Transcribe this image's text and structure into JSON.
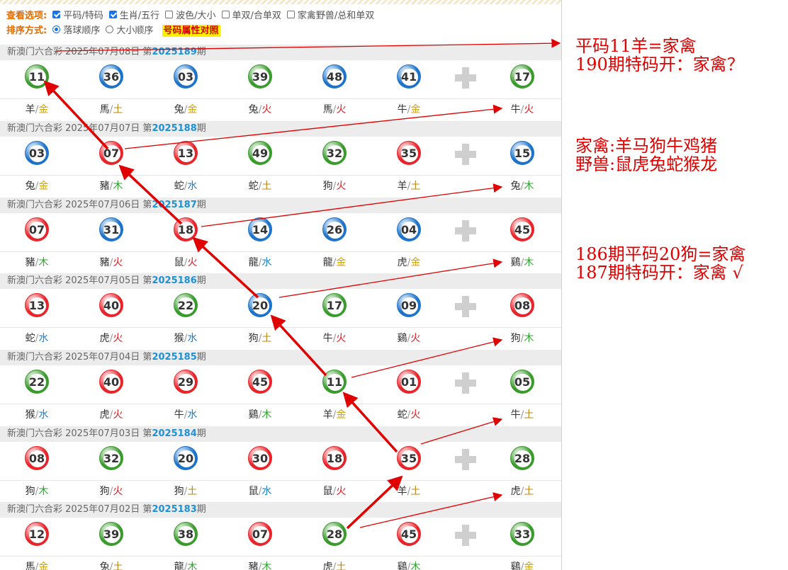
{
  "options": {
    "view_label": "查看选项:",
    "checkboxes": [
      {
        "label": "平码/特码",
        "checked": true
      },
      {
        "label": "生肖/五行",
        "checked": true
      },
      {
        "label": "波色/大小",
        "checked": false
      },
      {
        "label": "单双/合单双",
        "checked": false
      },
      {
        "label": "家禽野兽/总和单双",
        "checked": false
      }
    ],
    "sort_label": "排序方式:",
    "radios": [
      {
        "label": "落球顺序",
        "checked": true
      },
      {
        "label": "大小顺序",
        "checked": false
      }
    ],
    "attr_link": "号码属性对照"
  },
  "colors": {
    "red": "#e8242b",
    "blue": "#1d73c9",
    "green": "#3a9b2d",
    "gold": "#d4a200",
    "wood": "#2aa52a",
    "water": "#1a7fd0",
    "fire": "#e3181f",
    "earth": "#b8860b"
  },
  "draws": [
    {
      "prefix": "新澳门六合彩 2025年07月08日 第",
      "period": "2025189",
      "suffix": "期",
      "balls": [
        {
          "n": "11",
          "c": "green"
        },
        {
          "n": "36",
          "c": "blue"
        },
        {
          "n": "03",
          "c": "blue"
        },
        {
          "n": "39",
          "c": "green"
        },
        {
          "n": "48",
          "c": "blue"
        },
        {
          "n": "41",
          "c": "blue"
        },
        {
          "n": "17",
          "c": "green"
        }
      ],
      "zodiac": [
        {
          "z": "羊",
          "e": "金"
        },
        {
          "z": "馬",
          "e": "土"
        },
        {
          "z": "兔",
          "e": "金"
        },
        {
          "z": "兔",
          "e": "火"
        },
        {
          "z": "馬",
          "e": "火"
        },
        {
          "z": "牛",
          "e": "金"
        },
        {
          "z": "牛",
          "e": "火"
        }
      ]
    },
    {
      "prefix": "新澳门六合彩 2025年07月07日 第",
      "period": "2025188",
      "suffix": "期",
      "balls": [
        {
          "n": "03",
          "c": "blue"
        },
        {
          "n": "07",
          "c": "red"
        },
        {
          "n": "13",
          "c": "red"
        },
        {
          "n": "49",
          "c": "green"
        },
        {
          "n": "32",
          "c": "green"
        },
        {
          "n": "35",
          "c": "red"
        },
        {
          "n": "15",
          "c": "blue"
        }
      ],
      "zodiac": [
        {
          "z": "兔",
          "e": "金"
        },
        {
          "z": "豬",
          "e": "木"
        },
        {
          "z": "蛇",
          "e": "水"
        },
        {
          "z": "蛇",
          "e": "土"
        },
        {
          "z": "狗",
          "e": "火"
        },
        {
          "z": "羊",
          "e": "土"
        },
        {
          "z": "兔",
          "e": "木"
        }
      ]
    },
    {
      "prefix": "新澳门六合彩 2025年07月06日 第",
      "period": "2025187",
      "suffix": "期",
      "balls": [
        {
          "n": "07",
          "c": "red"
        },
        {
          "n": "31",
          "c": "blue"
        },
        {
          "n": "18",
          "c": "red"
        },
        {
          "n": "14",
          "c": "blue"
        },
        {
          "n": "26",
          "c": "blue"
        },
        {
          "n": "04",
          "c": "blue"
        },
        {
          "n": "45",
          "c": "red"
        }
      ],
      "zodiac": [
        {
          "z": "豬",
          "e": "木"
        },
        {
          "z": "豬",
          "e": "火"
        },
        {
          "z": "鼠",
          "e": "火"
        },
        {
          "z": "龍",
          "e": "水"
        },
        {
          "z": "龍",
          "e": "金"
        },
        {
          "z": "虎",
          "e": "金"
        },
        {
          "z": "鷄",
          "e": "木"
        }
      ]
    },
    {
      "prefix": "新澳门六合彩 2025年07月05日 第",
      "period": "2025186",
      "suffix": "期",
      "balls": [
        {
          "n": "13",
          "c": "red"
        },
        {
          "n": "40",
          "c": "red"
        },
        {
          "n": "22",
          "c": "green"
        },
        {
          "n": "20",
          "c": "blue"
        },
        {
          "n": "17",
          "c": "green"
        },
        {
          "n": "09",
          "c": "blue"
        },
        {
          "n": "08",
          "c": "red"
        }
      ],
      "zodiac": [
        {
          "z": "蛇",
          "e": "水"
        },
        {
          "z": "虎",
          "e": "火"
        },
        {
          "z": "猴",
          "e": "水"
        },
        {
          "z": "狗",
          "e": "土"
        },
        {
          "z": "牛",
          "e": "火"
        },
        {
          "z": "鷄",
          "e": "火"
        },
        {
          "z": "狗",
          "e": "木"
        }
      ]
    },
    {
      "prefix": "新澳门六合彩 2025年07月04日 第",
      "period": "2025185",
      "suffix": "期",
      "balls": [
        {
          "n": "22",
          "c": "green"
        },
        {
          "n": "40",
          "c": "red"
        },
        {
          "n": "29",
          "c": "red"
        },
        {
          "n": "45",
          "c": "red"
        },
        {
          "n": "11",
          "c": "green"
        },
        {
          "n": "01",
          "c": "red"
        },
        {
          "n": "05",
          "c": "green"
        }
      ],
      "zodiac": [
        {
          "z": "猴",
          "e": "水"
        },
        {
          "z": "虎",
          "e": "火"
        },
        {
          "z": "牛",
          "e": "水"
        },
        {
          "z": "鷄",
          "e": "木"
        },
        {
          "z": "羊",
          "e": "金"
        },
        {
          "z": "蛇",
          "e": "火"
        },
        {
          "z": "牛",
          "e": "土"
        }
      ]
    },
    {
      "prefix": "新澳门六合彩 2025年07月03日 第",
      "period": "2025184",
      "suffix": "期",
      "balls": [
        {
          "n": "08",
          "c": "red"
        },
        {
          "n": "32",
          "c": "green"
        },
        {
          "n": "20",
          "c": "blue"
        },
        {
          "n": "30",
          "c": "red"
        },
        {
          "n": "18",
          "c": "red"
        },
        {
          "n": "35",
          "c": "red"
        },
        {
          "n": "28",
          "c": "green"
        }
      ],
      "zodiac": [
        {
          "z": "狗",
          "e": "木"
        },
        {
          "z": "狗",
          "e": "火"
        },
        {
          "z": "狗",
          "e": "土"
        },
        {
          "z": "鼠",
          "e": "水"
        },
        {
          "z": "鼠",
          "e": "火"
        },
        {
          "z": "羊",
          "e": "土"
        },
        {
          "z": "虎",
          "e": "土"
        }
      ]
    },
    {
      "prefix": "新澳门六合彩 2025年07月02日 第",
      "period": "2025183",
      "suffix": "期",
      "balls": [
        {
          "n": "12",
          "c": "red"
        },
        {
          "n": "39",
          "c": "green"
        },
        {
          "n": "38",
          "c": "green"
        },
        {
          "n": "07",
          "c": "red"
        },
        {
          "n": "28",
          "c": "green"
        },
        {
          "n": "45",
          "c": "red"
        },
        {
          "n": "33",
          "c": "green"
        }
      ],
      "zodiac": [
        {
          "z": "馬",
          "e": "金"
        },
        {
          "z": "兔",
          "e": "土"
        },
        {
          "z": "龍",
          "e": "木"
        },
        {
          "z": "豬",
          "e": "木"
        },
        {
          "z": "虎",
          "e": "土"
        },
        {
          "z": "鷄",
          "e": "木"
        },
        {
          "z": "鷄",
          "e": "金"
        }
      ]
    }
  ],
  "notes": [
    {
      "lines": [
        "平码11羊=家禽",
        "190期特码开：家禽？"
      ]
    },
    {
      "lines": [
        "家禽:羊马狗牛鸡猪",
        "野兽:鼠虎兔蛇猴龙"
      ]
    },
    {
      "lines": [
        "186期平码20狗=家禽",
        "187期特码开：家禽 √"
      ]
    }
  ]
}
